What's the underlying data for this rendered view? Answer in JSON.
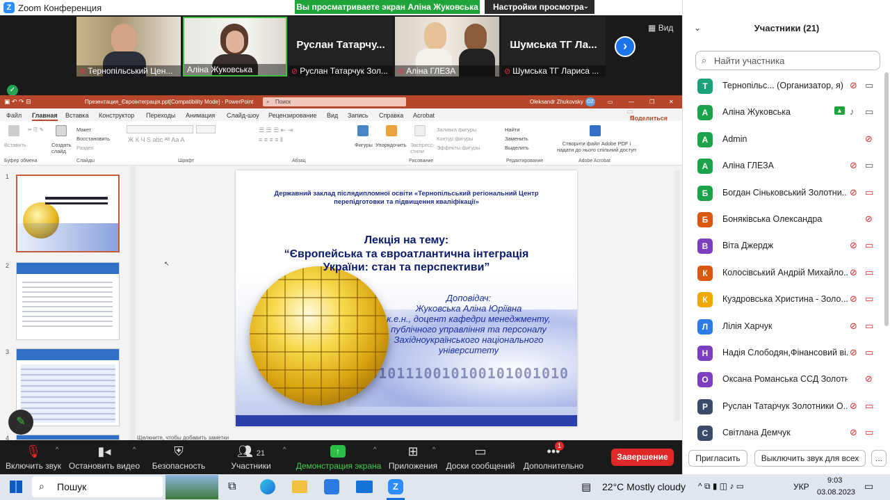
{
  "window": {
    "title": "Zoom Конференция",
    "share_banner": "Вы просматриваете экран Аліна Жуковська",
    "view_settings": "Настройки просмотра",
    "view_btn": "Вид"
  },
  "video_tiles": [
    {
      "label": "Тернопільський Цен..."
    },
    {
      "label": "Аліна Жуковська"
    },
    {
      "label": "Руслан Татарчук Зол...",
      "big": "Руслан  Татарчу..."
    },
    {
      "label": "Аліна ГЛЕЗА"
    },
    {
      "label": "Шумська ТГ Лариса ...",
      "big": "Шумська ТГ Ла..."
    }
  ],
  "ppt": {
    "title": "Презентация_Євроінтеграція.ppt[Compatibility Mode]  -  PowerPoint",
    "search": "Поиск",
    "user": "Oleksandr Zhukovsky",
    "user_initials": "OZ",
    "tabs": [
      "Файл",
      "Главная",
      "Вставка",
      "Конструктор",
      "Переходы",
      "Анимация",
      "Слайд-шоу",
      "Рецензирование",
      "Вид",
      "Запись",
      "Справка",
      "Acrobat"
    ],
    "share": "Поделиться",
    "ribbon": {
      "paste": "Вставить",
      "new_slide": "Создать слайд",
      "layout": "Макет",
      "reset": "Восстановить",
      "section": "Раздел",
      "shapes": "Фигуры",
      "arrange": "Упорядочить",
      "quick_styles": "Экспресс-стили",
      "fill": "Заливка фигуры",
      "outline": "Контур фигуры",
      "effects": "Эффекты фигуры",
      "find": "Найти",
      "replace": "Заменить",
      "select": "Выделить",
      "adobe": "Створити файл Adobe PDF і надати до нього спільний доступ",
      "groups": [
        "Буфер обмена",
        "Слайды",
        "Шрифт",
        "Абзац",
        "Рисование",
        "Редактирование",
        "Adobe Acrobat"
      ]
    },
    "slide_numbers": [
      "1",
      "2",
      "3",
      "4"
    ],
    "notes": "Щелкните, чтобы добавить заметки",
    "slide": {
      "header": "Державний заклад післядипломної освіти  «Тернопільський регіональний Центр перепідготовки та підвищення кваліфікації»",
      "lecture": "Лекція на тему:",
      "topic1": "“Європейська та євроатлантична інтеграція",
      "topic2": "України: стан та перспективи”",
      "speaker_label": "Доповідач:",
      "speaker": "Жуковська Аліна Юріївна",
      "pos1": "к.е.н., доцент кафедри менеджменту,",
      "pos2": "публічного управління та персоналу",
      "pos3": "Західноукраїнського національного",
      "pos4": "університету",
      "binary": "01010101110010100101001010"
    }
  },
  "toolbar": {
    "mute": "Включить звук",
    "video": "Остановить видео",
    "security": "Безопасность",
    "participants": "Участники",
    "participants_count": "21",
    "share": "Демонстрация экрана",
    "apps": "Приложения",
    "whiteboards": "Доски сообщений",
    "more": "Дополнительно",
    "more_badge": "1",
    "end": "Завершение"
  },
  "sidebar": {
    "title": "Участники (21)",
    "search_placeholder": "Найти участника",
    "participants": [
      {
        "initial": "Т",
        "name": "Тернопільс... (Организатор, я)",
        "color": "#1aa37a"
      },
      {
        "initial": "А",
        "name": "Аліна Жуковська",
        "color": "#1aa34a"
      },
      {
        "initial": "A",
        "name": "Admin",
        "color": "#1aa34a"
      },
      {
        "initial": "А",
        "name": "Аліна ГЛЕЗА",
        "color": "#1aa34a"
      },
      {
        "initial": "Б",
        "name": "Богдан Сіньковський Золотни...",
        "color": "#1aa34a"
      },
      {
        "initial": "Б",
        "name": "Боняківська Олександра",
        "color": "#d9580d"
      },
      {
        "initial": "В",
        "name": "Віта Джердж",
        "color": "#7b3fbf"
      },
      {
        "initial": "К",
        "name": "Колосівський Андрій Михайло...",
        "color": "#d9580d"
      },
      {
        "initial": "К",
        "name": "Куздровська Христина - Золо...",
        "color": "#f0a800"
      },
      {
        "initial": "Л",
        "name": "Лілія Харчук",
        "color": "#2d7be5"
      },
      {
        "initial": "Н",
        "name": "Надія Слободян,Фінансовий ві...",
        "color": "#7b3fbf"
      },
      {
        "initial": "О",
        "name": "Оксана Романська ССД Золотникі...",
        "color": "#7b3fbf"
      },
      {
        "initial": "Р",
        "name": "Руслан Татарчук Золотники О...",
        "color": "#3b4b6b"
      },
      {
        "initial": "С",
        "name": "Світлана Демчук",
        "color": "#3b4b6b"
      }
    ],
    "invite": "Пригласить",
    "mute_all": "Выключить звук для всех",
    "more": "..."
  },
  "taskbar": {
    "search": "Пошук",
    "weather": "22°C  Mostly cloudy",
    "lang": "УКР",
    "time": "9:03",
    "date": "03.08.2023"
  }
}
